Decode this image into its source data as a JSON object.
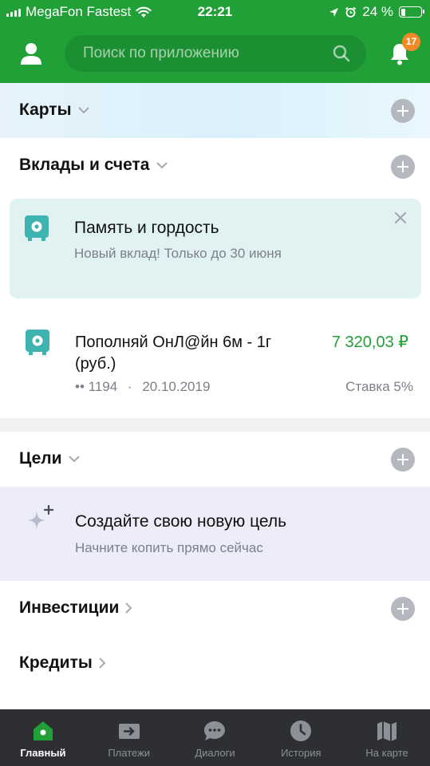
{
  "status_bar": {
    "carrier": "MegaFon Fastest",
    "time": "22:21",
    "battery": "24 %",
    "battery_level": 0.24
  },
  "header": {
    "search_placeholder": "Поиск по приложению",
    "notifications_count": "17",
    "icons": [
      "profile-icon",
      "search-icon",
      "bell-icon"
    ]
  },
  "sections": {
    "cards": {
      "title": "Карты"
    },
    "deposits": {
      "title": "Вклады и счета"
    },
    "goals": {
      "title": "Цели"
    },
    "investments": {
      "title": "Инвестиции"
    },
    "credits": {
      "title": "Кредиты"
    }
  },
  "promo": {
    "title": "Память и гордость",
    "subtitle": "Новый вклад! Только до 30 июня"
  },
  "deposit": {
    "name": "Пополняй ОнЛ@йн 6м - 1г (руб.)",
    "amount": "7 320,03 ₽",
    "account": "•• 1194",
    "separator": "·",
    "date": "20.10.2019",
    "rate": "Ставка 5%"
  },
  "goal": {
    "title": "Создайте свою новую цель",
    "subtitle": "Начните копить прямо сейчас"
  },
  "tabs": [
    {
      "label": "Главный",
      "icon": "home-icon",
      "active": true
    },
    {
      "label": "Платежи",
      "icon": "payments-icon",
      "active": false
    },
    {
      "label": "Диалоги",
      "icon": "chat-icon",
      "active": false
    },
    {
      "label": "История",
      "icon": "history-icon",
      "active": false
    },
    {
      "label": "На карте",
      "icon": "map-icon",
      "active": false
    }
  ],
  "colors": {
    "brand_green": "#21a038",
    "badge_orange": "#f08a24",
    "promo_bg": "#e0f3f2",
    "goal_bg": "#ecedf8",
    "tabbar_bg": "#2d2f33"
  }
}
